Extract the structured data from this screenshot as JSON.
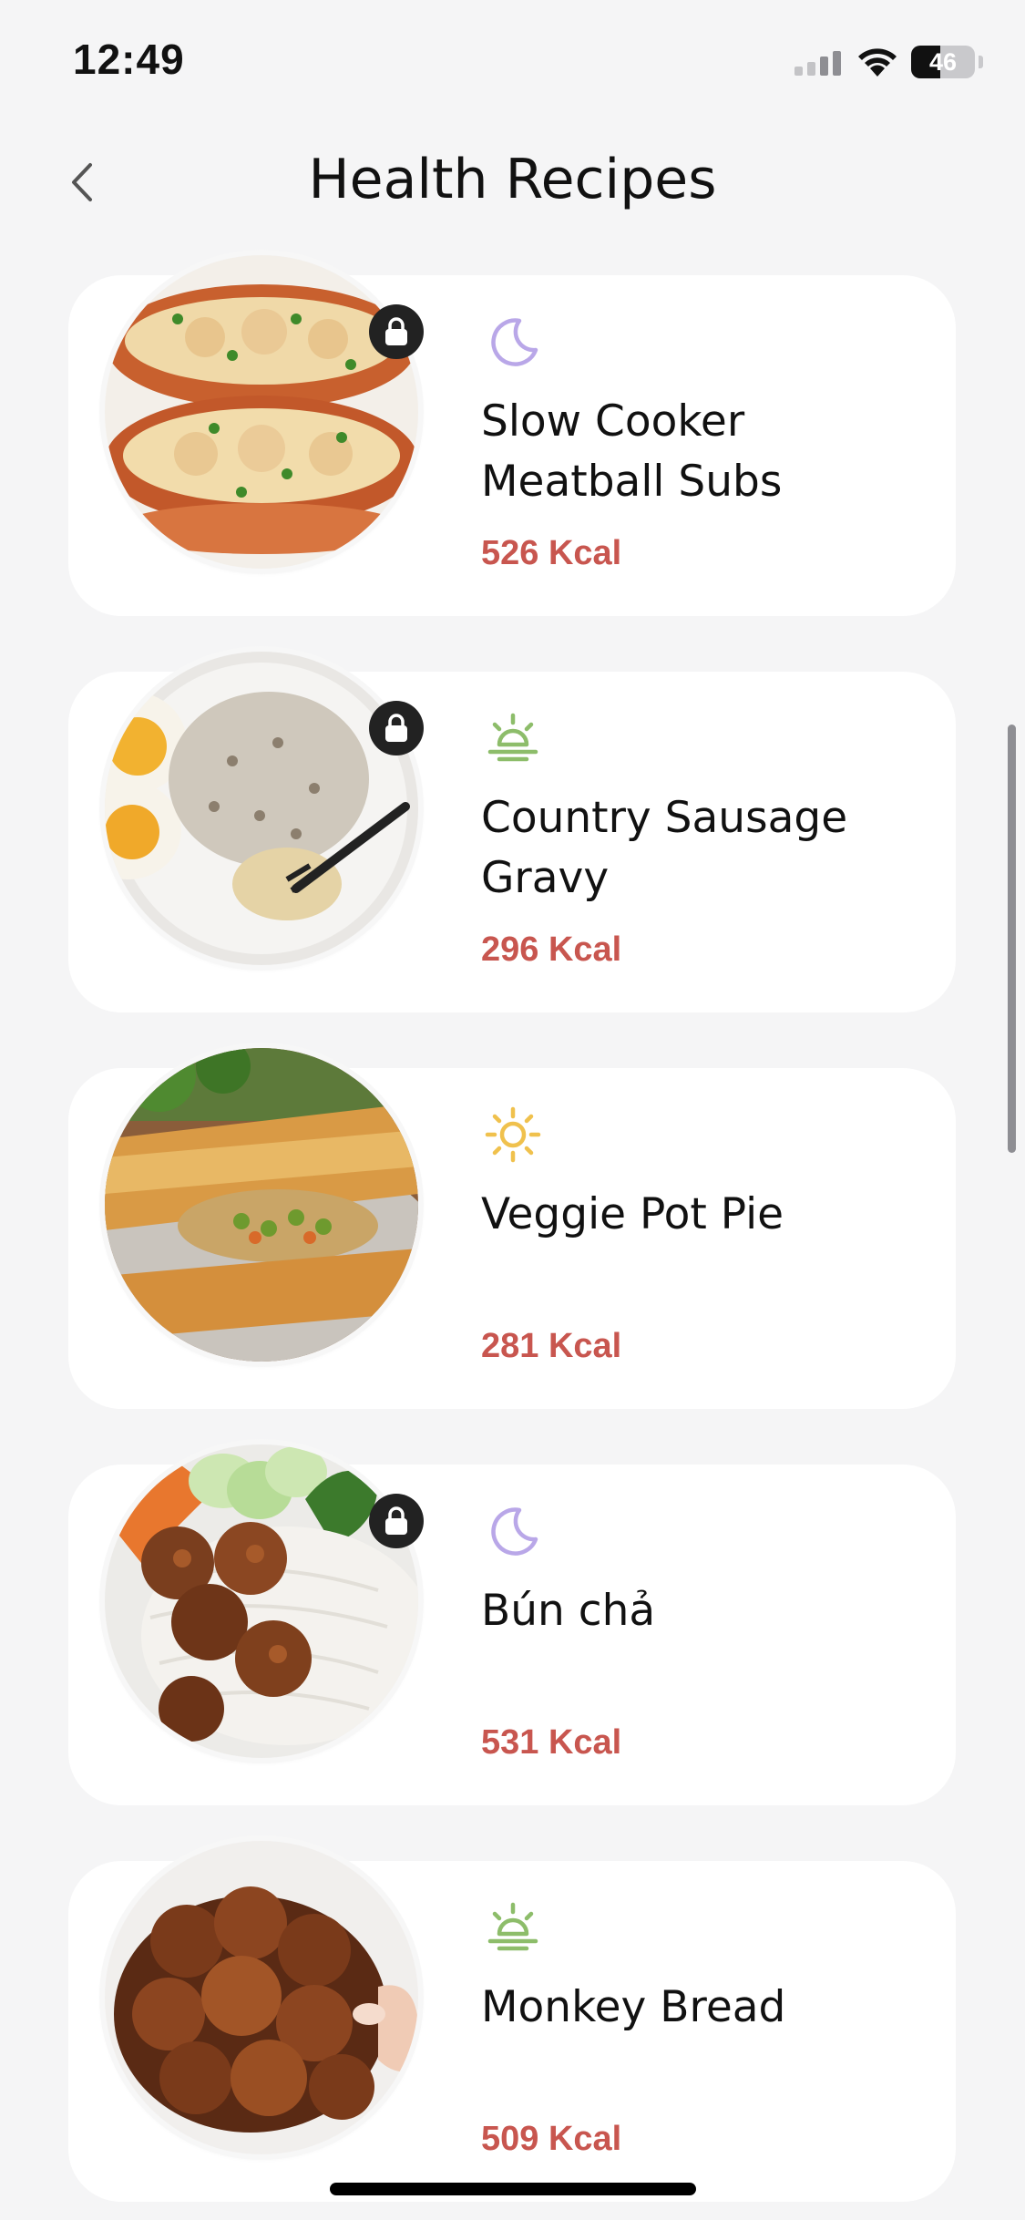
{
  "status_bar": {
    "time": "12:49",
    "battery_level": "46",
    "icons": [
      "cellular-signal-icon",
      "wifi-icon",
      "battery-icon"
    ]
  },
  "header": {
    "title": "Health Recipes",
    "back_icon": "chevron-left-icon"
  },
  "colors": {
    "kcal_text": "#c8564f",
    "moon_icon": "#b9a7e8",
    "sunrise_icon": "#8dbd6a",
    "sun_icon": "#f0c14d",
    "card_bg": "#ffffff",
    "page_bg": "#f5f5f6"
  },
  "recipes": [
    {
      "name": "Slow Cooker Meatball Subs",
      "kcal": "526 Kcal",
      "meal_icon": "moon-icon",
      "locked": true
    },
    {
      "name": "Country Sausage Gravy",
      "kcal": "296 Kcal",
      "meal_icon": "sunrise-icon",
      "locked": true
    },
    {
      "name": "Veggie Pot Pie",
      "kcal": "281 Kcal",
      "meal_icon": "sun-icon",
      "locked": false
    },
    {
      "name": "Bún chả",
      "kcal": "531 Kcal",
      "meal_icon": "moon-icon",
      "locked": true
    },
    {
      "name": "Monkey Bread",
      "kcal": "509 Kcal",
      "meal_icon": "sunrise-icon",
      "locked": false
    }
  ]
}
